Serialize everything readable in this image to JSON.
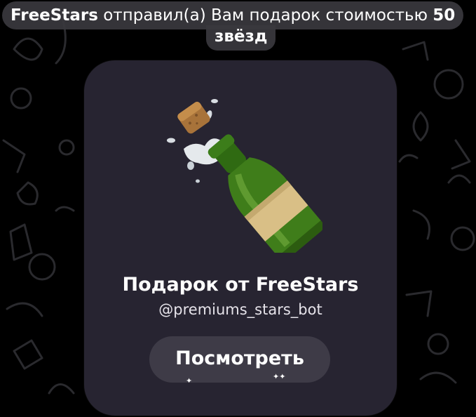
{
  "banner": {
    "sender": "FreeStars",
    "text_middle": " отправил(а) Вам подарок стоимостью ",
    "amount": "50",
    "unit": "звёзд"
  },
  "gift": {
    "emoji_name": "champagne-bottle-icon",
    "title": "Подарок от FreeStars",
    "bot_username": "@premiums_stars_bot",
    "view_button_label": "Посмотреть"
  },
  "colors": {
    "background": "#000000",
    "card": "#272431",
    "button": "#3e3b47",
    "banner": "#3a383e",
    "bottle_green": "#3f7d1a",
    "label_gold": "#d9bf86",
    "cork": "#b27a3a"
  }
}
